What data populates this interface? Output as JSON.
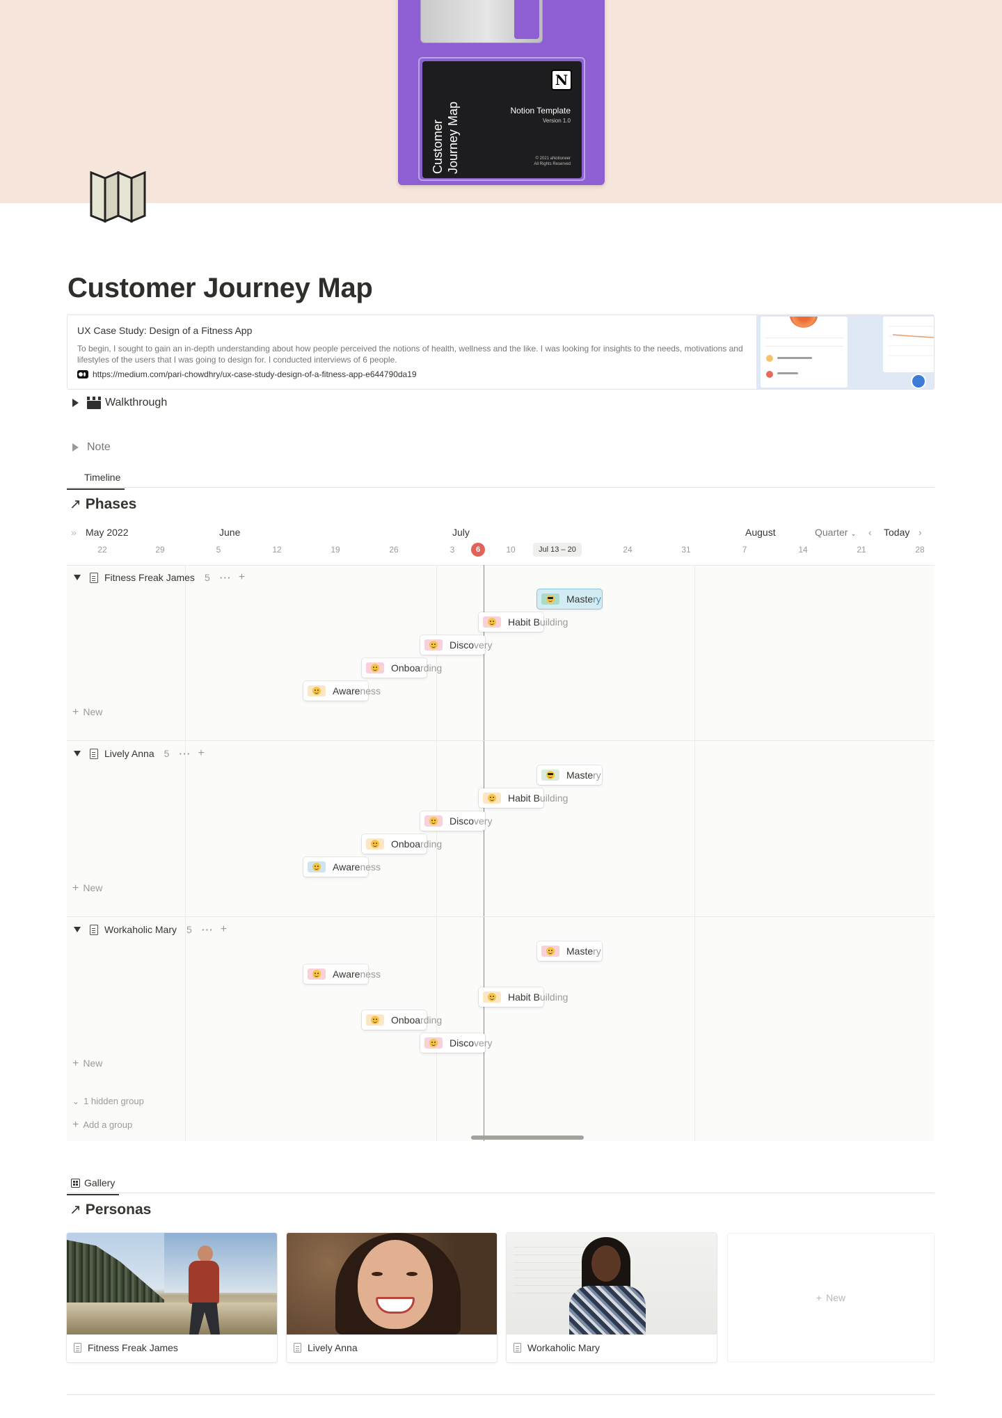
{
  "cover": {
    "floppy_title_line1": "Customer",
    "floppy_title_line2": "Journey Map",
    "notion_logo": "N",
    "notion_template": "Notion Template",
    "version": "Version 1.0",
    "copyright_line1": "© 2021 aNotioneer",
    "copyright_line2": "All Rights Reserved",
    "background_color": "#f6e5da",
    "floppy_color": "#8d5fd3"
  },
  "page_icon": "map-icon",
  "page_title": "Customer Journey Map",
  "bookmark": {
    "title": "UX Case Study: Design of a Fitness App",
    "description": "To begin, I sought to gain an in-depth understanding about how people perceived the notions of health, wellness and the like. I was looking for insights to the needs, motivations and lifestyles of the users that I was going to design for. I conducted interviews of 6 people.",
    "url": "https://medium.com/pari-chowdhry/ux-case-study-design-of-a-fitness-app-e644790da19",
    "site_icon": "medium-icon"
  },
  "toggles": {
    "walkthrough": "Walkthrough",
    "walkthrough_icon": "clapper-board-icon",
    "note": "Note"
  },
  "timeline_view": {
    "tab_label": "Timeline",
    "title": "Phases",
    "months": [
      "May 2022",
      "June",
      "July",
      "August"
    ],
    "days": [
      "22",
      "29",
      "5",
      "12",
      "19",
      "26",
      "3",
      "10",
      "24",
      "31",
      "7",
      "14",
      "21",
      "28"
    ],
    "today_day": "6",
    "week_range": "Jul 13 – 20",
    "zoom": "Quarter",
    "today_button": "Today",
    "today_line_color": "#e16259",
    "groups": [
      {
        "name": "Fitness Freak James",
        "count": "5",
        "items": [
          {
            "head": "Maste",
            "tail": "ry"
          },
          {
            "head": "Habit B",
            "tail": "uilding"
          },
          {
            "head": "Disco",
            "tail": "very"
          },
          {
            "head": "Onboa",
            "tail": "rding"
          },
          {
            "head": "Aware",
            "tail": "ness"
          }
        ]
      },
      {
        "name": "Lively Anna",
        "count": "5",
        "items": [
          {
            "head": "Maste",
            "tail": "ry"
          },
          {
            "head": "Habit B",
            "tail": "uilding"
          },
          {
            "head": "Disco",
            "tail": "very"
          },
          {
            "head": "Onboa",
            "tail": "rding"
          },
          {
            "head": "Aware",
            "tail": "ness"
          }
        ]
      },
      {
        "name": "Workaholic Mary",
        "count": "5",
        "items": [
          {
            "head": "Maste",
            "tail": "ry"
          },
          {
            "head": "Aware",
            "tail": "ness"
          },
          {
            "head": "Habit B",
            "tail": "uilding"
          },
          {
            "head": "Onboa",
            "tail": "rding"
          },
          {
            "head": "Disco",
            "tail": "very"
          }
        ]
      }
    ],
    "new_label": "New",
    "hidden_group": "1 hidden group",
    "add_group": "Add a group"
  },
  "gallery_view": {
    "tab_label": "Gallery",
    "title": "Personas",
    "cards": [
      "Fitness Freak James",
      "Lively Anna",
      "Workaholic Mary"
    ],
    "new_label": "New"
  }
}
